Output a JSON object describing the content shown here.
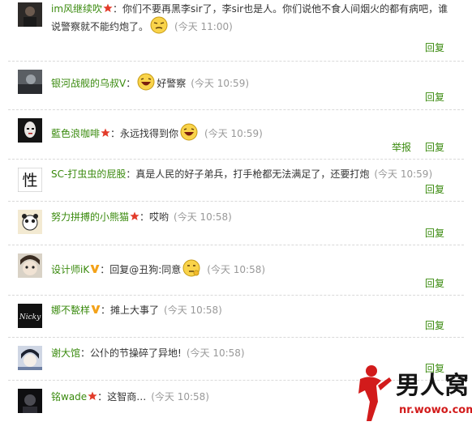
{
  "colors": {
    "accent_green": "#3a8a0e",
    "time_gray": "#999999",
    "badge_red": "#e23b2a",
    "badge_orange": "#f3a21a"
  },
  "comments": [
    {
      "user": "im风继续吹",
      "badge": "star-red",
      "text": "你们不要再黑李sir了，李sir也是人。你们说他不食人间烟火的都有病吧，谁说警察就不能约炮了。",
      "emoticon": "smirk-emoticon",
      "time": "(今天 11:00)",
      "reply": "回复"
    },
    {
      "user": "银河战舰的乌叔V",
      "badge": "",
      "text_before": "",
      "emoticon": "laugh-emoticon",
      "text": "好警察",
      "time": "(今天 10:59)",
      "reply": "回复"
    },
    {
      "user": "藍色浪咖啡",
      "badge": "star-red",
      "text": "永远找得到你",
      "emoticon": "laugh-emoticon",
      "time": "(今天 10:59)",
      "report": "举报",
      "reply": "回复"
    },
    {
      "user": "SC-打虫虫的屁股",
      "badge": "",
      "text": "真是人民的好子弟兵，打手枪都无法满足了，还要打炮",
      "time": "(今天 10:59)",
      "reply": "回复"
    },
    {
      "user": "努力拼搏的小熊猫",
      "badge": "star-red",
      "text": "哎哟",
      "time": "(今天 10:58)",
      "reply": "回复"
    },
    {
      "user": "设计师iK",
      "badge": "v-orange",
      "text": "回复@丑狗:同意",
      "emoticon": "think-emoticon",
      "time": "(今天 10:58)",
      "reply": "回复"
    },
    {
      "user": "娜不甃样",
      "badge": "v-orange",
      "text": "摊上大事了",
      "time": "(今天 10:58)",
      "reply": "回复"
    },
    {
      "user": "谢大馆",
      "badge": "",
      "text": "公仆的节操碎了异地!",
      "time": "(今天 10:58)",
      "reply": "回复"
    },
    {
      "user": "铭wade",
      "badge": "star-red",
      "text": "这智商…",
      "time": "(今天 10:58)"
    }
  ],
  "avatar_texts": {
    "calligraphy": "性",
    "nicky": "Nicky"
  },
  "watermark": {
    "title": "男人窝",
    "url": "nr.wowo.com"
  }
}
